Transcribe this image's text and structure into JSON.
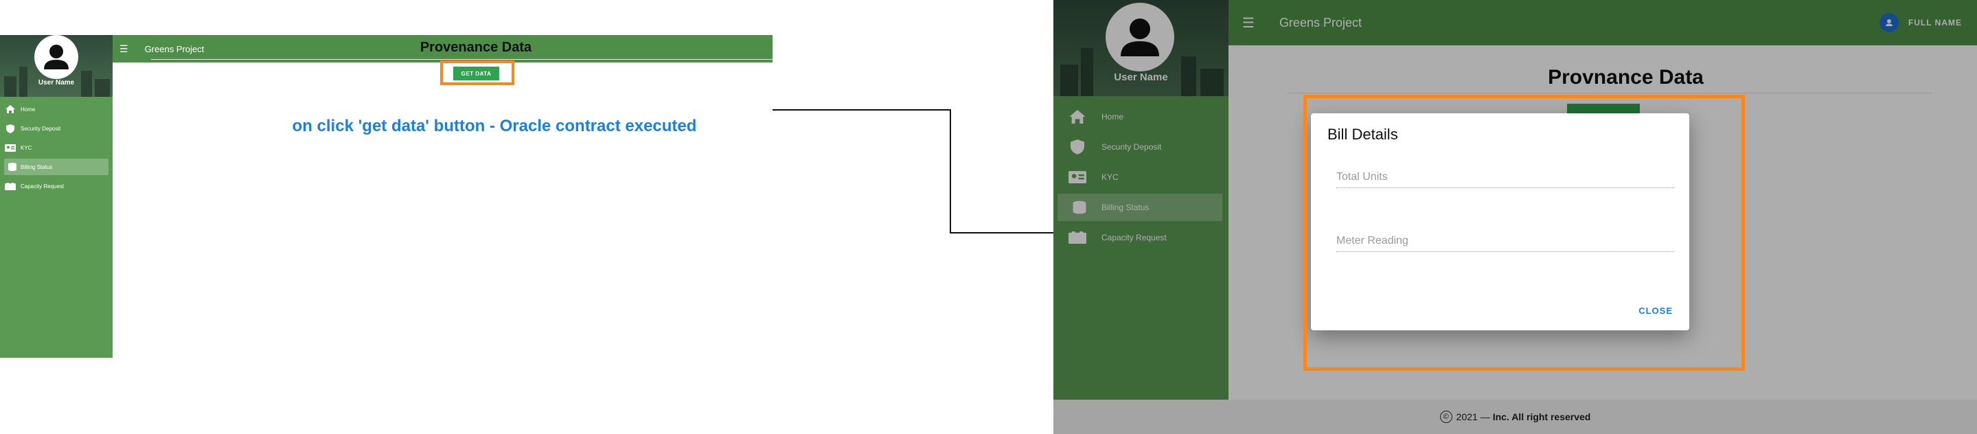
{
  "left_screen": {
    "sidebar": {
      "user_name": "User Name",
      "items": [
        {
          "label": "Home",
          "icon": "home-icon"
        },
        {
          "label": "Security Deposit",
          "icon": "shield-icon"
        },
        {
          "label": "KYC",
          "icon": "id-card-icon"
        },
        {
          "label": "Billing Status",
          "icon": "coins-icon",
          "active": true
        },
        {
          "label": "Capacity Request",
          "icon": "ticket-icon"
        }
      ]
    },
    "header": {
      "title": "Greens Project"
    },
    "page_title": "Provenance Data",
    "get_data_label": "GET DATA",
    "annotation": "on click 'get data' button - Oracle contract executed"
  },
  "right_screen": {
    "sidebar": {
      "user_name": "User Name",
      "items": [
        {
          "label": "Home",
          "icon": "home-icon"
        },
        {
          "label": "Security Deposit",
          "icon": "shield-icon"
        },
        {
          "label": "KYC",
          "icon": "id-card-icon"
        },
        {
          "label": "Billing Status",
          "icon": "coins-icon",
          "active": true
        },
        {
          "label": "Capacity Request",
          "icon": "ticket-icon"
        }
      ]
    },
    "header": {
      "title": "Greens Project",
      "user_label": "FULL NAME"
    },
    "page_title": "Provnance Data",
    "dialog": {
      "title": "Bill Details",
      "fields": [
        {
          "placeholder": "Total Units",
          "value": ""
        },
        {
          "placeholder": "Meter Reading",
          "value": ""
        }
      ],
      "close_label": "CLOSE"
    },
    "footer": {
      "copyright_symbol": "©",
      "year_text": "2021 —",
      "company_text": "Inc. All right reserved"
    }
  },
  "colors": {
    "sidebar_green": "#5a9a52",
    "header_green": "#4f8e48",
    "button_green": "#2ea44f",
    "highlight_orange": "#f5891f",
    "annotation_blue": "#1a7fe0"
  }
}
